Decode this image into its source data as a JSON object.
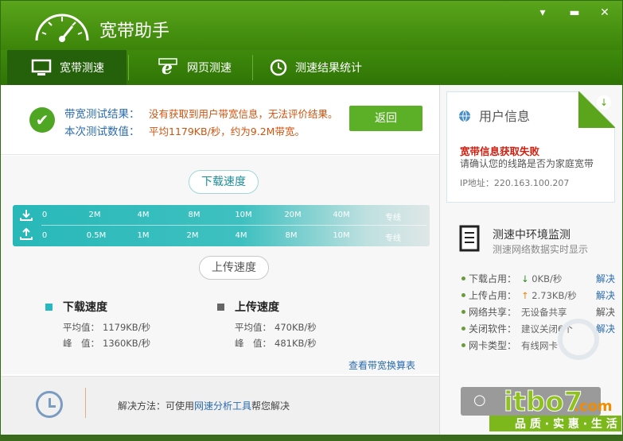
{
  "window": {
    "title": "宽带助手",
    "icons": [
      "gauge-icon",
      "menu-arrow-icon",
      "minimize-icon",
      "close-icon"
    ]
  },
  "tabs": [
    {
      "label": "宽带测速",
      "icon": "monitor-icon",
      "active": true
    },
    {
      "label": "网页测速",
      "icon": "ie-icon",
      "active": false
    },
    {
      "label": "测速结果统计",
      "icon": "clock-icon",
      "active": false
    }
  ],
  "result": {
    "label1": "带宽测试结果：",
    "value1": "没有获取到用户带宽信息，无法评价结果。",
    "label2": "本次测试数值：",
    "value2": "平均1179KB/秒，约为9.2M带宽。",
    "back_label": "返回"
  },
  "speed": {
    "download_bubble": "下载速度",
    "upload_bubble": "上传速度",
    "download_ticks": [
      "0",
      "2M",
      "4M",
      "8M",
      "10M",
      "20M",
      "40M",
      "专线"
    ],
    "upload_ticks": [
      "0",
      "0.5M",
      "1M",
      "2M",
      "4M",
      "8M",
      "10M",
      "专线"
    ]
  },
  "stats": {
    "download": {
      "title": "下载速度",
      "avg_label": "平均值：",
      "avg": "1179KB/秒",
      "peak_label": "峰　值：",
      "peak": "1360KB/秒",
      "color": "#27b8c0"
    },
    "upload": {
      "title": "上传速度",
      "avg_label": "平均值：",
      "avg": "470KB/秒",
      "peak_label": "峰　值：",
      "peak": "481KB/秒",
      "color": "#666666"
    },
    "converter_link": "查看带宽换算表"
  },
  "footer": {
    "prefix": "解决方法：可使用",
    "link": "网速分析工具",
    "suffix": "帮您解决"
  },
  "user_info": {
    "title": "用户信息",
    "error": "宽带信息获取失败",
    "hint": "请确认您的线路是否为家庭宽带",
    "ip": "IP地址：220.163.100.207"
  },
  "env": {
    "title": "测速中环境监测",
    "subtitle": "测速网络数据实时显示",
    "rows": [
      {
        "key": "下载占用：",
        "value": "0KB/秒",
        "action": "解决",
        "arrow": "down"
      },
      {
        "key": "上传占用：",
        "value": "2.73KB/秒",
        "action": "解决",
        "arrow": "up"
      },
      {
        "key": "网络共享：",
        "value": "无设备共享",
        "action": "解决"
      },
      {
        "key": "关闭软件：",
        "value": "建议关闭6个",
        "action": "解决"
      },
      {
        "key": "网卡类型：",
        "value": "有线网卡",
        "action": ""
      }
    ]
  },
  "watermark": {
    "logo": "itbo7.com",
    "slogan": "品质·实惠·生活"
  }
}
